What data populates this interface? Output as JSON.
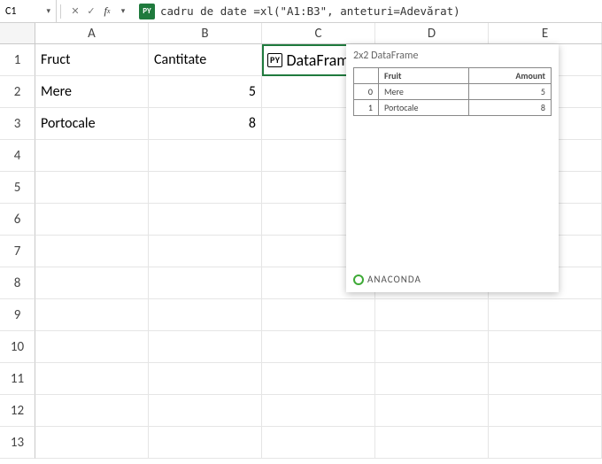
{
  "formula_bar": {
    "cell_ref": "C1",
    "py_badge": "PY",
    "expr_label": "cadru de date = ",
    "expr_code": "xl(\"A1:B3\", anteturi=Adevărat)"
  },
  "columns": [
    "A",
    "B",
    "C",
    "D",
    "E"
  ],
  "rows": [
    "1",
    "2",
    "3",
    "4",
    "5",
    "6",
    "7",
    "8",
    "9",
    "10",
    "11",
    "12",
    "13"
  ],
  "cells": {
    "A1": "Fruct",
    "B1": "Cantitate",
    "A2": "Mere",
    "B2": "5",
    "A3": "Portocale",
    "B3": "8"
  },
  "df_cell": {
    "icon": "PY",
    "label": "DataFrame"
  },
  "card": {
    "title": "2x2 DataFrame",
    "headers": [
      "",
      "Fruit",
      "Amount"
    ],
    "rows": [
      {
        "idx": "0",
        "fruit": "Mere",
        "amount": "5"
      },
      {
        "idx": "1",
        "fruit": "Portocale",
        "amount": "8"
      }
    ],
    "footer": "ANACONDA"
  },
  "chart_data": {
    "type": "table",
    "title": "2x2 DataFrame",
    "columns": [
      "Fruit",
      "Amount"
    ],
    "rows": [
      {
        "index": 0,
        "Fruit": "Mere",
        "Amount": 5
      },
      {
        "index": 1,
        "Fruit": "Portocale",
        "Amount": 8
      }
    ]
  }
}
